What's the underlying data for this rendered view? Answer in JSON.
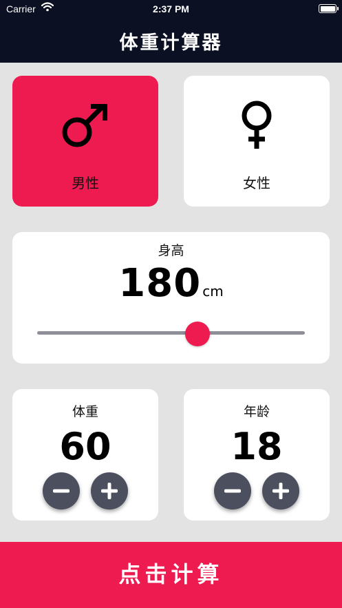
{
  "status_bar": {
    "carrier": "Carrier",
    "time": "2:37 PM"
  },
  "nav": {
    "title": "体重计算器"
  },
  "gender": {
    "selected": "male",
    "male": {
      "label": "男性",
      "icon": "male-symbol-icon"
    },
    "female": {
      "label": "女性",
      "icon": "female-symbol-icon"
    }
  },
  "height": {
    "label": "身高",
    "value": "180",
    "unit": "cm",
    "slider_level": 0.6
  },
  "weight": {
    "label": "体重",
    "value": "60",
    "decrement_icon": "minus-icon",
    "increment_icon": "plus-icon"
  },
  "age": {
    "label": "年龄",
    "value": "18",
    "decrement_icon": "minus-icon",
    "increment_icon": "plus-icon"
  },
  "calculate_button": {
    "label": "点击计算"
  },
  "colors": {
    "bar_background": "#0b1023",
    "accent": "#ed1b50",
    "page_background": "#e3e3e3",
    "card_background": "#ffffff",
    "control_button": "#4c4f5e",
    "slider_track": "#8d8e98"
  }
}
